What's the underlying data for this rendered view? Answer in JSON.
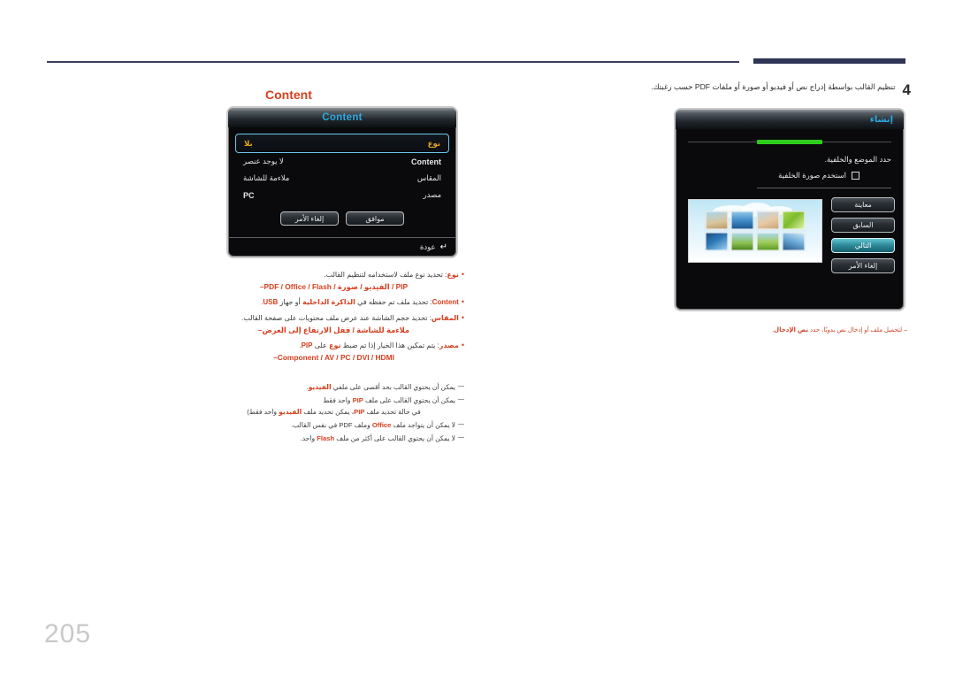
{
  "page": {
    "number": "205"
  },
  "step": {
    "number": "4",
    "text": "تنظيم القالب بواسطة إدراج نص أو فيديو أو صورة أو ملفات PDF حسب رغبتك."
  },
  "create_dialog": {
    "title": "إنشاء",
    "heading": "حدد الموضع والخلفية.",
    "checkbox_label": "استخدم صورة الخلفية",
    "checkbox_checked": false,
    "buttons": [
      {
        "label": "معاينة",
        "selected": false
      },
      {
        "label": "السابق",
        "selected": false
      },
      {
        "label": "التالي",
        "selected": true
      },
      {
        "label": "إلغاء الأمر",
        "selected": false
      }
    ],
    "progress_color": "#2ecc1d",
    "title_color": "#2aa9e0"
  },
  "right_note": {
    "prefix": "–  لتحميل ملف أو إدخال نص يدويًا، حدد ",
    "keyword": "نص الإدخال",
    "suffix": ".",
    "color": "#d4452b"
  },
  "content_heading": "Content",
  "content_dialog": {
    "title": "Content",
    "title_color": "#2aa9e0",
    "rows": [
      {
        "label": "نوع",
        "value": "بلا",
        "highlight": true,
        "label_ltr": false,
        "value_ltr": false
      },
      {
        "label": "Content",
        "value": "لا يوجد عنصر",
        "highlight": false,
        "label_ltr": true,
        "value_ltr": false
      },
      {
        "label": "المقاس",
        "value": "ملاءمة للشاشة",
        "highlight": false,
        "label_ltr": false,
        "value_ltr": false
      },
      {
        "label": "مصدر",
        "value": "PC",
        "highlight": false,
        "label_ltr": false,
        "value_ltr": true
      }
    ],
    "buttons": [
      {
        "label": "موافق"
      },
      {
        "label": "إلغاء الأمر"
      }
    ],
    "footer": {
      "icon": "return-arrow-icon",
      "label": "عودة"
    }
  },
  "bullets": [
    {
      "lead": "نوع",
      "text": ": تحديد نوع ملف لاستخدامه لتنظيم القالب.",
      "sub": "PIP / الفيديو / صورة / PDF / Office / Flash–"
    },
    {
      "lead": "Content",
      "lead_ltr": true,
      "text_before": ": تحديد ملف تم حفظه في ",
      "kw1": "الذاكرة الداخلية",
      "text_mid": " أو جهاز ",
      "kw2": "USB",
      "text_after": ".",
      "sub": ""
    },
    {
      "lead": "المقاس",
      "text": ": تحديد حجم الشاشة عند عرض ملف محتويات على صفحة القالب.",
      "sub": "ملاءمة للشاشة / قفل الارتفاع إلى العرض–"
    },
    {
      "lead": "مصدر",
      "text_before": ": يتم تمكين هذا الخيار إذا تم ضبط ",
      "kw1": "نوع",
      "text_mid": " على ",
      "kw2": "PIP",
      "text_after": ".",
      "sub": "Component / AV / PC / DVI / HDMI–"
    }
  ],
  "dashes": [
    {
      "before": "يمكن أن يحتوي القالب بحد أقصى على ملفي ",
      "kw": "الفيديو",
      "after": "."
    },
    {
      "before": "يمكن أن يحتوي القالب على ملف ",
      "kw": "PIP",
      "after": " واحد فقط"
    },
    {
      "paren": "في حالة تحديد ملف ",
      "kw": "PIP",
      "paren_mid": "، يمكن تحديد ملف ",
      "kw2": "الفيديو",
      "paren_after": " واحد فقط)",
      "continuation": true
    },
    {
      "before": "لا يمكن أن يتواجد ملف ",
      "kw": "Office",
      "after": " وملف PDF في نفس القالب."
    },
    {
      "before": "لا يمكن أن يحتوي القالب على أكثر من ملف ",
      "kw": "Flash",
      "after": " واحد."
    }
  ],
  "colors": {
    "accent_red": "#d6401f",
    "rule_navy": "#3a3f5c",
    "osd_blue": "#2aa9e0",
    "osd_yellow": "#e8a820"
  }
}
